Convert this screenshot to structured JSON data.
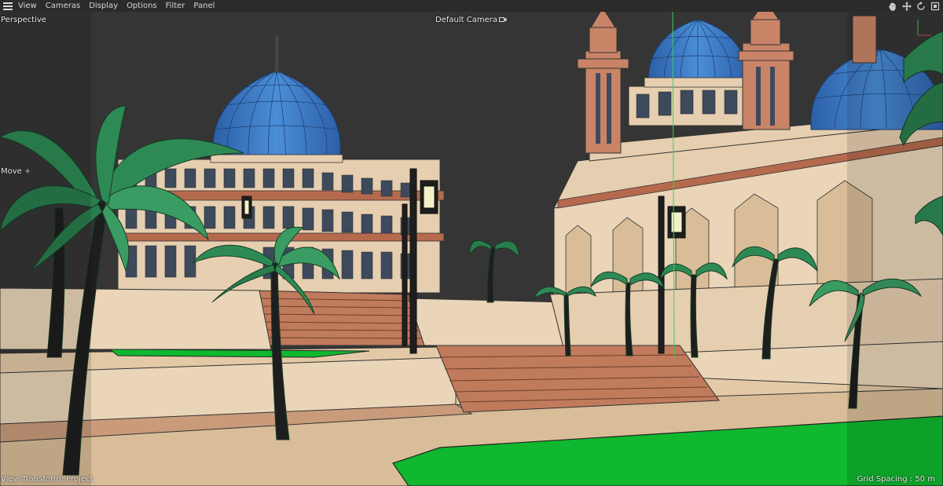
{
  "menu": {
    "items": [
      "View",
      "Cameras",
      "Display",
      "Options",
      "Filter",
      "Panel"
    ]
  },
  "nav_icons": [
    "hand-pan-icon",
    "move-arrows-icon",
    "rotate-orbit-icon",
    "view-cube-icon"
  ],
  "viewport": {
    "view_name": "Perspective",
    "camera_label": "Default Camera",
    "tool_name": "Move",
    "view_transform": "View Transform: Project",
    "grid_spacing": "Grid Spacing : 50 m"
  },
  "colors": {
    "menubar_bg": "#2b2b2b",
    "viewport_bg": "#353535",
    "dome_blue": "#3a78c9",
    "wall_beige": "#e6cfb0",
    "trim_brown": "#b56a4e",
    "palm_green": "#2e8a55",
    "grass_green": "#0fb82e"
  }
}
